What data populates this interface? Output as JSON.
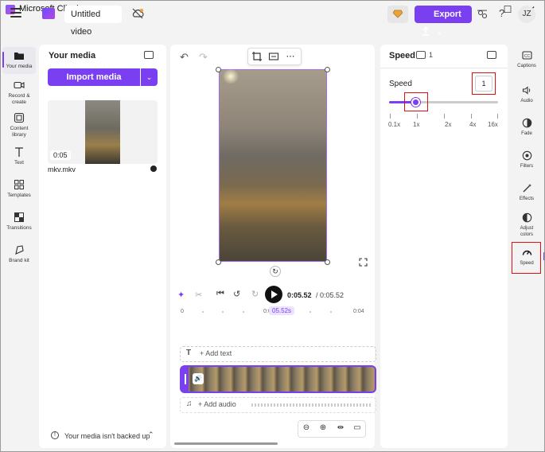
{
  "window": {
    "title": "Microsoft Clipchamp",
    "minimize": "—",
    "maximize": "☐",
    "close": "✕"
  },
  "topbar": {
    "project_title": "Untitled video",
    "export_label": "Export",
    "help_label": "?",
    "avatar_initials": "JZ",
    "accent_color": "#7b3ff2"
  },
  "left_nav": {
    "items": [
      {
        "label": "Your media",
        "icon": "folder-icon"
      },
      {
        "label": "Record & create",
        "icon": "camera-icon"
      },
      {
        "label": "Content library",
        "icon": "library-icon"
      },
      {
        "label": "Text",
        "icon": "text-icon"
      },
      {
        "label": "Templates",
        "icon": "templates-icon"
      },
      {
        "label": "Transitions",
        "icon": "transitions-icon"
      },
      {
        "label": "Brand kit",
        "icon": "brand-kit-icon"
      }
    ]
  },
  "media": {
    "title": "Your media",
    "import_label": "Import media",
    "file_name": "mkv.mkv",
    "file_duration": "0:05",
    "backup_text": "Your media isn't backed up"
  },
  "preview": {
    "rotate_glyph": "↻"
  },
  "playback": {
    "current_time": "0:05.52",
    "total_time": "/ 0:05.52",
    "playhead_label": "05.52s",
    "ruler_labels": [
      "0",
      "0:0",
      "0:04"
    ]
  },
  "timeline": {
    "add_text": "+ Add text",
    "add_audio": "+ Add audio"
  },
  "speed_panel": {
    "title": "Speed",
    "badge_count": "1",
    "speed_label": "Speed",
    "speed_value": "1",
    "slider_level": 0.25,
    "tick_labels": [
      "0.1x",
      "1x",
      "2x",
      "4x",
      "16x"
    ]
  },
  "right_nav": {
    "items": [
      {
        "label": "Captions",
        "icon": "captions-icon"
      },
      {
        "label": "Audio",
        "icon": "speaker-icon"
      },
      {
        "label": "Fade",
        "icon": "fade-icon"
      },
      {
        "label": "Filters",
        "icon": "filters-icon"
      },
      {
        "label": "Effects",
        "icon": "effects-icon"
      },
      {
        "label": "Adjust colors",
        "icon": "adjust-colors-icon"
      },
      {
        "label": "Speed",
        "icon": "speedometer-icon"
      }
    ]
  }
}
